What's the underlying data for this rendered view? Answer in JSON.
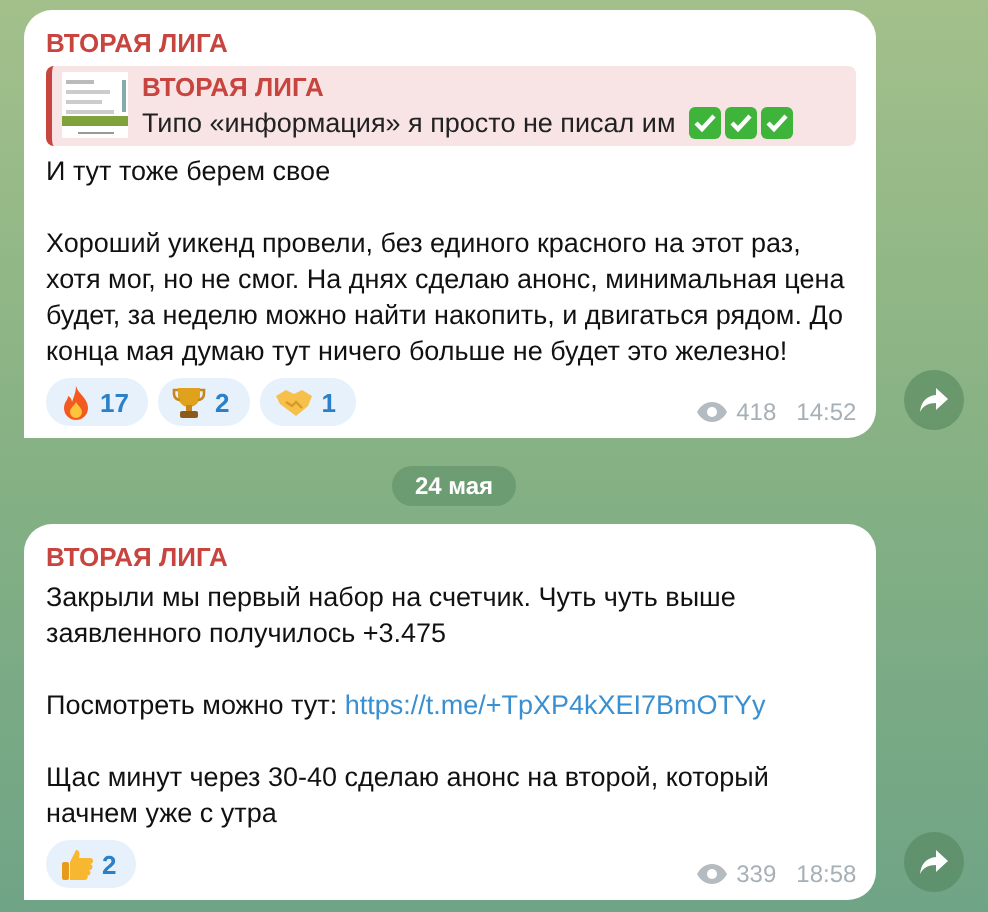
{
  "messages": [
    {
      "sender": "ВТОРАЯ ЛИГА",
      "reply": {
        "sender": "ВТОРАЯ ЛИГА",
        "text": "Типо «информация» я просто не писал им",
        "marks": [
          {
            "kind": "check"
          },
          {
            "kind": "check"
          },
          {
            "kind": "check"
          }
        ]
      },
      "paragraphs": [
        {
          "text": "И тут тоже берем свое"
        },
        {
          "text": "Хороший уикенд провели, без единого красного на этот раз, хотя мог, но не смог. На днях сделаю анонс, минимальная цена будет, за неделю можно найти накопить, и двигаться рядом. До конца мая думаю тут ничего больше не будет это железно!"
        }
      ],
      "reactions": [
        {
          "kind": "fire",
          "count": "17"
        },
        {
          "kind": "trophy",
          "count": "2"
        },
        {
          "kind": "handshake",
          "count": "1"
        }
      ],
      "views": "418",
      "time": "14:52"
    },
    {
      "date": "24 мая"
    },
    {
      "sender": "ВТОРАЯ ЛИГА",
      "paragraphs": [
        {
          "text": "Закрыли мы первый набор на счетчик. Чуть чуть выше заявленного получилось +3.475"
        },
        {
          "text": "Посмотреть можно тут:",
          "link": "https://t.me/+TpXP4kXEI7BmOTYy"
        },
        {
          "text": "Щас минут через 30-40 сделаю анонс на второй, который начнем уже с утра"
        }
      ],
      "reactions": [
        {
          "kind": "thumbs",
          "count": "2"
        }
      ],
      "views": "339",
      "time": "18:58"
    }
  ]
}
